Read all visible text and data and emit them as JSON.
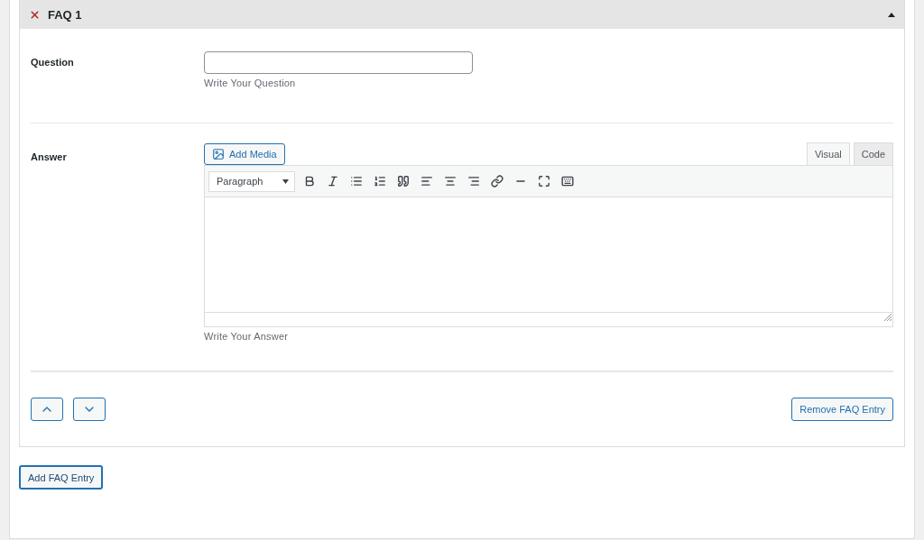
{
  "faq": {
    "title": "FAQ 1",
    "expanded": true,
    "question": {
      "label": "Question",
      "hint": "Write Your Question"
    },
    "answer": {
      "label": "Answer",
      "add_media": "Add Media",
      "hint": "Write Your Answer",
      "tabs": [
        {
          "label": "Visual",
          "selected": true
        },
        {
          "label": "Code",
          "selected": false
        }
      ],
      "format": "Paragraph",
      "toolbar": [
        {
          "kind": "bold"
        },
        {
          "kind": "italic"
        },
        {
          "kind": "bullets"
        },
        {
          "kind": "numbers"
        },
        {
          "kind": "quote"
        },
        {
          "kind": "left"
        },
        {
          "kind": "center"
        },
        {
          "kind": "right"
        },
        {
          "kind": "link"
        },
        {
          "kind": "more"
        },
        {
          "kind": "fullscreen"
        },
        {
          "kind": "keyboard"
        }
      ]
    },
    "remove": "Remove FAQ Entry"
  },
  "add_entry": "Add FAQ Entry"
}
